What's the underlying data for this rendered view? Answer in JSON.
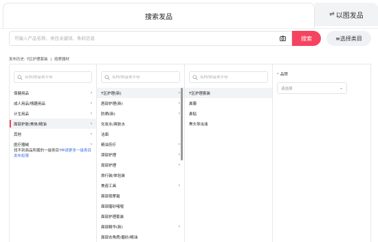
{
  "tabs": {
    "active_label": "搜索发品",
    "other_label": "以图发品",
    "other_icon": "swap-arrows-icon"
  },
  "search": {
    "placeholder": "可输入产品名称、类目关键词、条码信息",
    "camera_icon": "camera-icon",
    "button_label": "搜索",
    "choose_label": "≡选择类目"
  },
  "history": {
    "prefix": "发布历史:",
    "items": [
      "T区护理套装",
      "按摩器材"
    ]
  },
  "columns": {
    "col1": {
      "search_placeholder": "名称/拼音首字母",
      "items": [
        {
          "label": "保健用品",
          "arrow": "›"
        },
        {
          "label": "成人用品/情趣用品",
          "arrow": "›"
        },
        {
          "label": "计生用品",
          "arrow": "›"
        },
        {
          "label": "面部护肤/美体/精油",
          "arrow": "›"
        },
        {
          "label": "其他",
          "arrow": "›"
        },
        {
          "label": "医疗器械",
          "arrow": "›"
        }
      ],
      "selected_index": 3,
      "note_text": "找不到商品所属的一级类目?",
      "note_link": "申请更多一级类目发布权限"
    },
    "col2": {
      "search_placeholder": "名称/拼音首字母",
      "items": [
        {
          "label": "T区护理(新)",
          "arrow": "›"
        },
        {
          "label": "唇部护理(新)",
          "arrow": "›"
        },
        {
          "label": "防晒(新)",
          "arrow": "›"
        },
        {
          "label": "化妆水/爽肤水",
          "arrow": ""
        },
        {
          "label": "洁面",
          "arrow": ""
        },
        {
          "label": "精油芳疗",
          "arrow": "›"
        },
        {
          "label": "颈部护理",
          "arrow": "›"
        },
        {
          "label": "局部护理",
          "arrow": "›"
        },
        {
          "label": "旅行装/体验装",
          "arrow": ""
        },
        {
          "label": "美容工具",
          "arrow": "›"
        },
        {
          "label": "面部按摩霜",
          "arrow": ""
        },
        {
          "label": "面部磨砂啫喱",
          "arrow": ""
        },
        {
          "label": "面部护理套装",
          "arrow": ""
        },
        {
          "label": "面部精华(新)",
          "arrow": "›"
        },
        {
          "label": "面部去角质/磨砂/精油",
          "arrow": ""
        }
      ],
      "selected_index": 0
    },
    "col3": {
      "search_placeholder": "名称/拼音首字母",
      "items": [
        {
          "label": "T区护理套装",
          "arrow": ""
        },
        {
          "label": "鼻膜",
          "arrow": ""
        },
        {
          "label": "鼻贴",
          "arrow": ""
        },
        {
          "label": "黑头导出液",
          "arrow": ""
        }
      ],
      "selected_index": 0
    },
    "col4": {
      "required_mark": "*",
      "brand_label": "品牌",
      "brand_placeholder": "请选择"
    }
  },
  "colors": {
    "accent": "#f5445f",
    "link": "#3d6fe0",
    "selected_bg": "#f2f3f5"
  }
}
